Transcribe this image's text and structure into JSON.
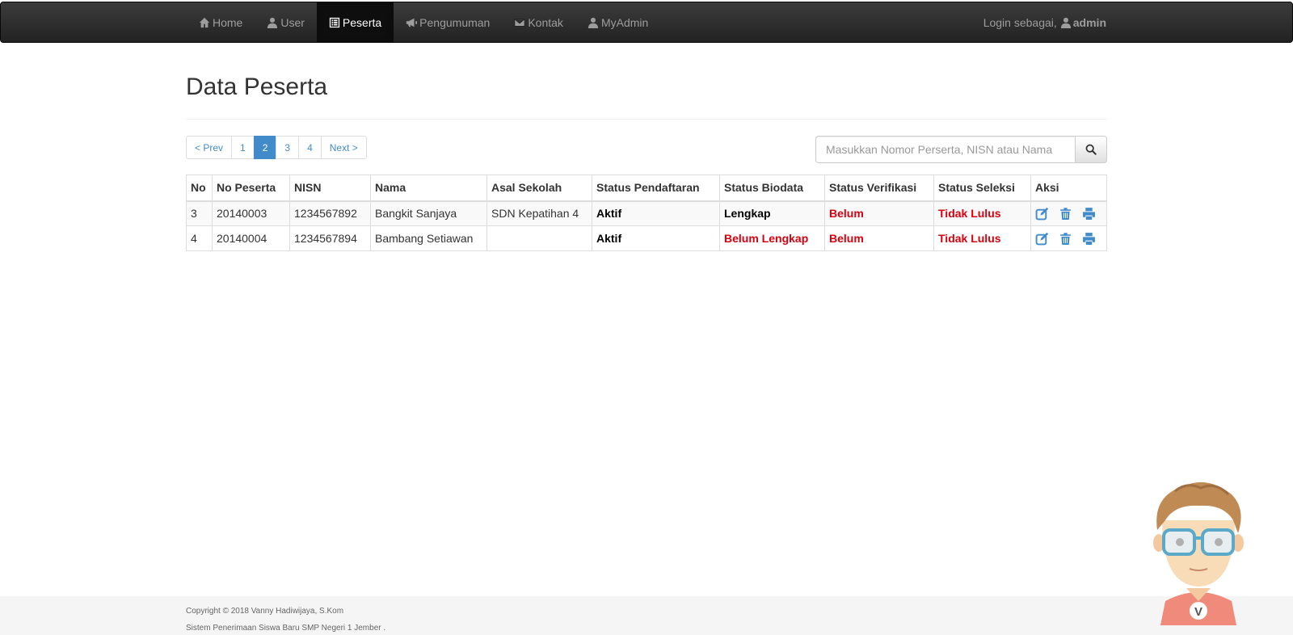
{
  "nav": {
    "items": [
      {
        "label": "Home",
        "icon": "home-icon"
      },
      {
        "label": "User",
        "icon": "user-icon"
      },
      {
        "label": "Peserta",
        "icon": "list-alt-icon",
        "active": true
      },
      {
        "label": "Pengumuman",
        "icon": "bullhorn-icon"
      },
      {
        "label": "Kontak",
        "icon": "envelope-icon"
      },
      {
        "label": "MyAdmin",
        "icon": "user-icon"
      }
    ],
    "login_prefix": "Login sebagai,",
    "login_user": "admin"
  },
  "page": {
    "title": "Data Peserta"
  },
  "pagination": {
    "prev": "< Prev",
    "pages": [
      "1",
      "2",
      "3",
      "4"
    ],
    "active_page": "2",
    "next": "Next >"
  },
  "search": {
    "placeholder": "Masukkan Nomor Perserta, NISN atau Nama",
    "icon": "search-icon"
  },
  "table": {
    "headers": [
      "No",
      "No Peserta",
      "NISN",
      "Nama",
      "Asal Sekolah",
      "Status Pendaftaran",
      "Status Biodata",
      "Status Verifikasi",
      "Status Seleksi",
      "Aksi"
    ],
    "rows": [
      {
        "no": "3",
        "no_peserta": "20140003",
        "nisn": "1234567892",
        "nama": "Bangkit Sanjaya",
        "asal_sekolah": "SDN Kepatihan 4",
        "status_pendaftaran": "Aktif",
        "status_biodata": "Lengkap",
        "status_verifikasi": "Belum",
        "status_seleksi": "Tidak Lulus"
      },
      {
        "no": "4",
        "no_peserta": "20140004",
        "nisn": "1234567894",
        "nama": "Bambang Setiawan",
        "asal_sekolah": "",
        "status_pendaftaran": "Aktif",
        "status_biodata": "Belum Lengkap",
        "status_verifikasi": "Belum",
        "status_seleksi": "Tidak Lulus"
      }
    ],
    "action_icons": [
      "edit-icon",
      "trash-icon",
      "print-icon"
    ]
  },
  "footer": {
    "copyright": "Copyright © 2018 Vanny Hadiwijaya, S.Kom",
    "app_name": "Sistem Penerimaan Siswa Baru SMP Negeri 1 Jember ."
  },
  "colors": {
    "navbar_bg": "#222222",
    "link_blue": "#428bca",
    "status_red": "#d9000e",
    "footer_bg": "#f5f5f5"
  }
}
